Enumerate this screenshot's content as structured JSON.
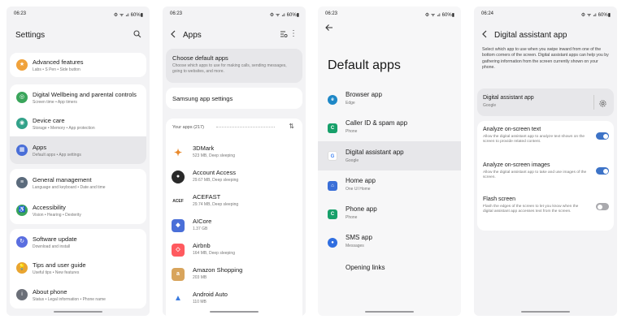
{
  "colors": {
    "accent": "#3d73c7",
    "screen_bg": "#f3f3f5",
    "card_bg": "#ffffff",
    "highlight": "#e7e7ea"
  },
  "status": {
    "s1": {
      "time": "06:23",
      "icons": "⚙ ᯤ ⊿ 60%▮"
    },
    "s2": {
      "time": "06:23",
      "icons": "⚙ ᯤ ⊿ 60%▮"
    },
    "s3": {
      "time": "06:23",
      "icons": "⚙ ᯤ ⊿ 60%▮"
    },
    "s4": {
      "time": "06:24",
      "icons": "⚙ ᯤ ⊿ 60%▮"
    }
  },
  "settings": {
    "title": "Settings",
    "items": [
      {
        "title": "Advanced features",
        "sub": "Labs  •  S Pen  •  Side button",
        "icon": "star-icon",
        "color": "#f0a23b"
      },
      {
        "title": "Digital Wellbeing and parental controls",
        "sub": "Screen time  •  App timers",
        "icon": "wellbeing-icon",
        "color": "#3aa55b"
      },
      {
        "title": "Device care",
        "sub": "Storage  •  Memory  •  App protection",
        "icon": "device-care-icon",
        "color": "#33a28a"
      },
      {
        "title": "Apps",
        "sub": "Default apps  •  App settings",
        "icon": "apps-icon",
        "color": "#4a6fd8"
      },
      {
        "title": "General management",
        "sub": "Language and keyboard  •  Date and time",
        "icon": "sliders-icon",
        "color": "#5b6b7c"
      },
      {
        "title": "Accessibility",
        "sub": "Vision  •  Hearing  •  Dexterity",
        "icon": "accessibility-icon",
        "color": "#3aa55b"
      },
      {
        "title": "Software update",
        "sub": "Download and install",
        "icon": "update-icon",
        "color": "#5a6ee0"
      },
      {
        "title": "Tips and user guide",
        "sub": "Useful tips  •  New features",
        "icon": "tips-icon",
        "color": "#e9a530"
      },
      {
        "title": "About phone",
        "sub": "Status  •  Legal information  •  Phone name",
        "icon": "info-icon",
        "color": "#6b6f78"
      }
    ]
  },
  "apps": {
    "title": "Apps",
    "choose_default": {
      "title": "Choose default apps",
      "sub": "Choose which apps to use for making calls, sending messages, going to websites, and more."
    },
    "samsung_settings": "Samsung app settings",
    "your_apps": "Your apps (217)",
    "list": [
      {
        "name": "3DMark",
        "meta": "523 MB, Deep sleeping",
        "icon": "3dmark-icon",
        "color": "#e98a2d",
        "glyph": "✦"
      },
      {
        "name": "Account Access",
        "meta": "29.67 MB, Deep sleeping",
        "icon": "account-access-icon",
        "color": "#2a2a2a",
        "glyph": "●"
      },
      {
        "name": "ACEFAST",
        "meta": "29.74 MB, Deep sleeping",
        "icon": "acefast-icon",
        "color": "#ffffff",
        "glyph": "~"
      },
      {
        "name": "AICore",
        "meta": "1.37 GB",
        "icon": "aicore-icon",
        "color": "#4a6fd8",
        "glyph": "◆"
      },
      {
        "name": "Airbnb",
        "meta": "164 MB, Deep sleeping",
        "icon": "airbnb-icon",
        "color": "#ff5a5f",
        "glyph": "◇"
      },
      {
        "name": "Amazon Shopping",
        "meta": "203 MB",
        "icon": "amazon-icon",
        "color": "#d8a45c",
        "glyph": "a"
      },
      {
        "name": "Android Auto",
        "meta": "110 MB",
        "icon": "android-auto-icon",
        "color": "#3a7be0",
        "glyph": "▲"
      }
    ]
  },
  "defaults": {
    "title": "Default apps",
    "list": [
      {
        "name": "Browser app",
        "value": "Edge",
        "icon": "edge-icon",
        "color": "#1e88c7",
        "glyph": "e"
      },
      {
        "name": "Caller ID & spam app",
        "value": "Phone",
        "icon": "phone-icon",
        "color": "#17a06a",
        "glyph": "C"
      },
      {
        "name": "Digital assistant app",
        "value": "Google",
        "icon": "google-icon",
        "color": "#ffffff",
        "glyph": "G"
      },
      {
        "name": "Home app",
        "value": "One UI Home",
        "icon": "home-icon",
        "color": "#3a6fd8",
        "glyph": "⌂"
      },
      {
        "name": "Phone app",
        "value": "Phone",
        "icon": "phone-app-icon",
        "color": "#17a06a",
        "glyph": "C"
      },
      {
        "name": "SMS app",
        "value": "Messages",
        "icon": "messages-icon",
        "color": "#2f6ee0",
        "glyph": "●"
      },
      {
        "name": "Opening links",
        "value": "",
        "icon": "",
        "color": "",
        "glyph": ""
      }
    ]
  },
  "assistant": {
    "title": "Digital assistant app",
    "intro": "Select which app to use when you swipe inward from one of the bottom corners of the screen. Digital assistant apps can help you by gathering information from the screen currently shown on your phone.",
    "selected": {
      "title": "Digital assistant app",
      "value": "Google"
    },
    "toggles": [
      {
        "title": "Analyze on-screen text",
        "desc": "Allow the digital assistant app to analyze text shown on the screen to provide related content.",
        "on": true
      },
      {
        "title": "Analyze on-screen images",
        "desc": "Allow the digital assistant app to take and use images of the screen.",
        "on": true
      },
      {
        "title": "Flash screen",
        "desc": "Flash the edges of the screen to let you know when the digital assistant app accesses text from the screen.",
        "on": false
      }
    ]
  }
}
